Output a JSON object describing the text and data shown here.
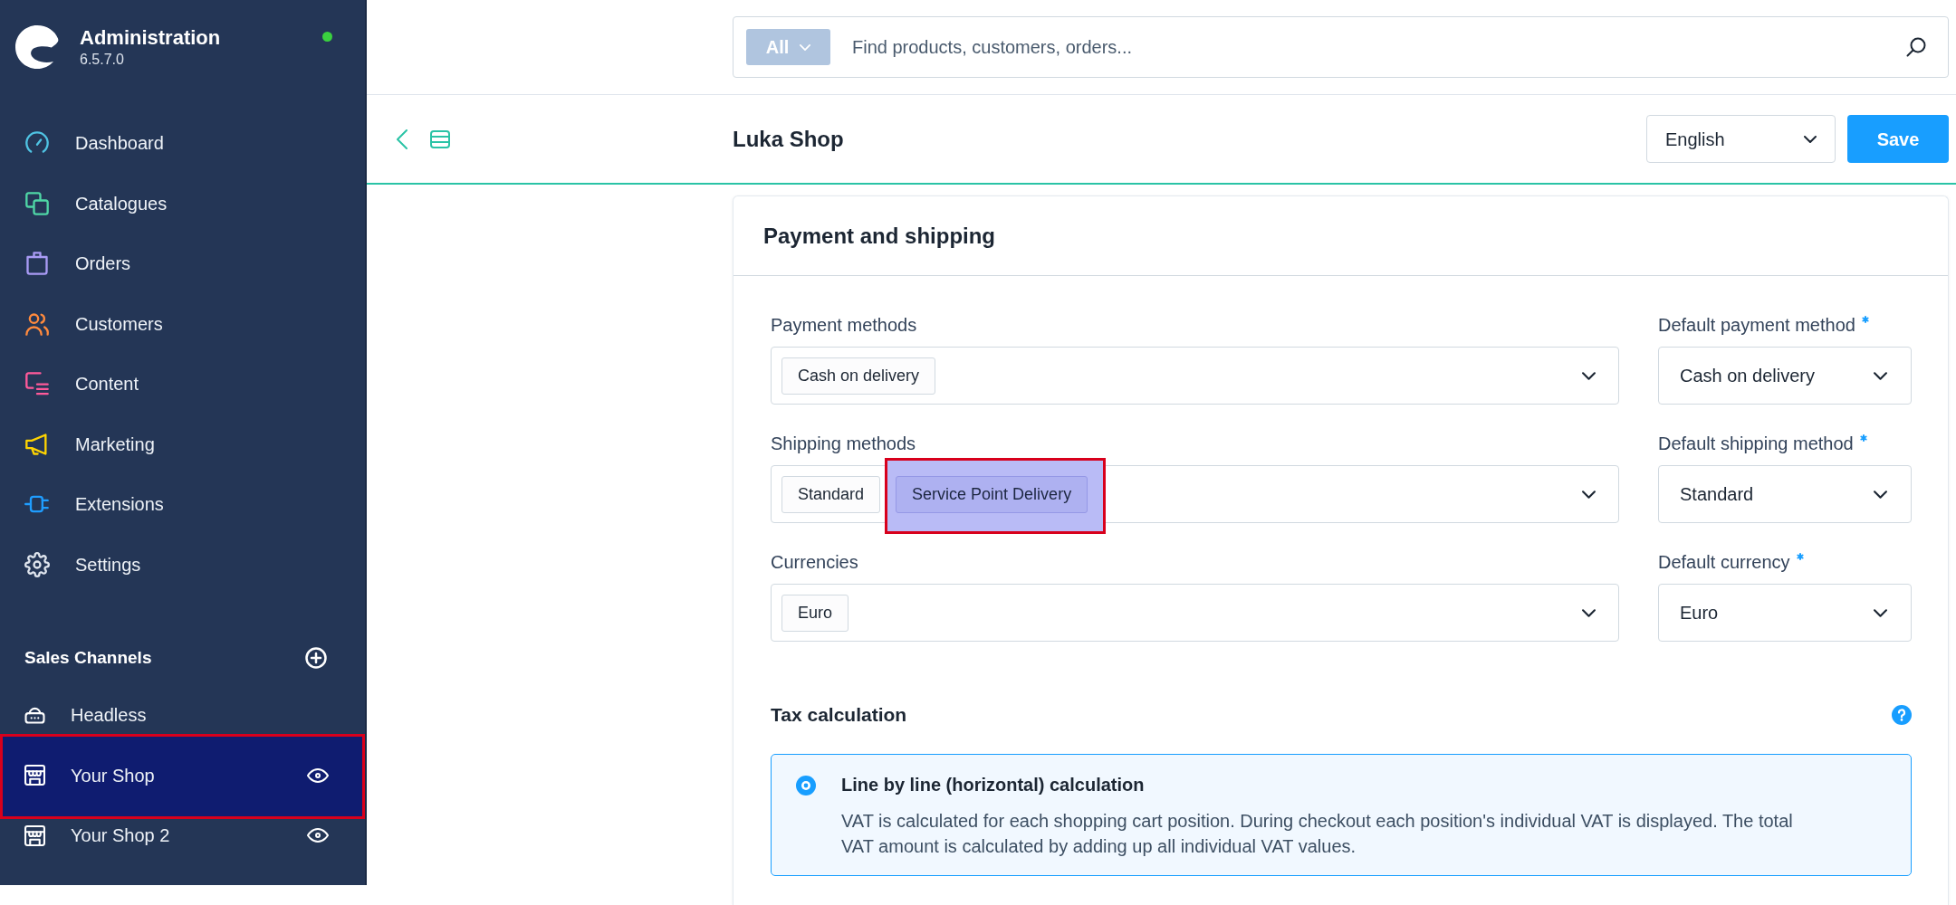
{
  "sidebar": {
    "title": "Administration",
    "version": "6.5.7.0",
    "online": true,
    "nav": [
      {
        "label": "Dashboard",
        "color": "#4fc3e3"
      },
      {
        "label": "Catalogues",
        "color": "#4fd6a6"
      },
      {
        "label": "Orders",
        "color": "#a99bf5"
      },
      {
        "label": "Customers",
        "color": "#ff8a3d"
      },
      {
        "label": "Content",
        "color": "#ff5a9a"
      },
      {
        "label": "Marketing",
        "color": "#ffd400"
      },
      {
        "label": "Extensions",
        "color": "#1f9dff"
      },
      {
        "label": "Settings",
        "color": "#dfe5ee"
      }
    ],
    "sales_channels": {
      "title": "Sales Channels",
      "items": [
        {
          "kind": "headless",
          "label": "Headless",
          "highlighted": false
        },
        {
          "kind": "storefront",
          "label": "Your Shop",
          "highlighted": true
        },
        {
          "kind": "storefront",
          "label": "Your Shop 2",
          "highlighted": false
        }
      ]
    }
  },
  "search": {
    "scope": "All",
    "placeholder": "Find products, customers, orders..."
  },
  "header": {
    "title": "Luka Shop",
    "language": "English",
    "save": "Save"
  },
  "card": {
    "title": "Payment and shipping",
    "rows": [
      {
        "multi": {
          "label": "Payment methods",
          "chips": [
            {
              "label": "Cash on delivery",
              "highlighted": false
            }
          ]
        },
        "default": {
          "label": "Default payment method",
          "required": true,
          "value": "Cash on delivery"
        }
      },
      {
        "multi": {
          "label": "Shipping methods",
          "chips": [
            {
              "label": "Standard",
              "highlighted": false
            },
            {
              "label": "Service Point Delivery",
              "highlighted": true
            }
          ]
        },
        "default": {
          "label": "Default shipping method",
          "required": true,
          "value": "Standard"
        }
      },
      {
        "multi": {
          "label": "Currencies",
          "chips": [
            {
              "label": "Euro",
              "highlighted": false
            }
          ]
        },
        "default": {
          "label": "Default currency",
          "required": true,
          "value": "Euro"
        }
      }
    ],
    "tax": {
      "title": "Tax calculation",
      "options": [
        {
          "title": "Line by line (horizontal) calculation",
          "description": "VAT is calculated for each shopping cart position. During checkout each position's individual VAT is displayed. The total VAT amount is calculated by adding up all individual VAT values.",
          "selected": true
        }
      ]
    }
  }
}
